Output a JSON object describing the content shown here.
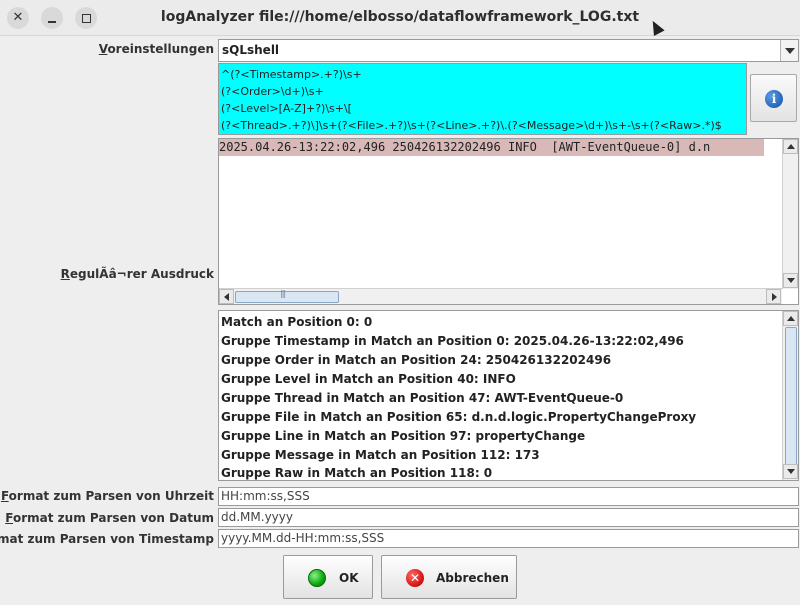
{
  "window": {
    "title": "logAnalyzer file:///home/elbosso/dataflowframework_LOG.txt",
    "close_glyph": "✕"
  },
  "presets": {
    "label_first": "V",
    "label_rest": "oreinstellungen",
    "selected": "sQLshell"
  },
  "regex": {
    "label_first": "R",
    "label_rest": "egulÃâ¬rer Ausdruck",
    "lines": [
      "^(?<Timestamp>.+?)\\s+",
      "(?<Order>\\d+)\\s+",
      "(?<Level>[A-Z]+?)\\s+\\[",
      "(?<Thread>.+?)\\]\\s+(?<File>.+?)\\s+(?<Line>.+?)\\.(?<Message>\\d+)\\s+-\\s+(?<Raw>.*)$"
    ],
    "info_glyph": "i"
  },
  "sample": {
    "line": "2025.04.26-13:22:02,496 250426132202496 INFO  [AWT-EventQueue-0] d.n"
  },
  "results": [
    "Match an Position 0: 0",
    "Gruppe Timestamp in Match an Position 0: 2025.04.26-13:22:02,496",
    "Gruppe Order in Match an Position 24: 250426132202496",
    "Gruppe Level in Match an Position 40: INFO",
    "Gruppe Thread in Match an Position 47: AWT-EventQueue-0",
    "Gruppe File in Match an Position 65: d.n.d.logic.PropertyChangeProxy",
    "Gruppe Line in Match an Position 97: propertyChange",
    "Gruppe Message in Match an Position 112: 173",
    "Gruppe Raw in Match an Position 118: 0"
  ],
  "formats": {
    "time": {
      "label_first": "F",
      "label_rest": "ormat zum Parsen von Uhrzeit",
      "value": "HH:mm:ss,SSS"
    },
    "date": {
      "label_first": "F",
      "label_rest": "ormat zum Parsen von Datum",
      "value": "dd.MM.yyyy"
    },
    "timestamp": {
      "label_first": "F",
      "label_rest": "ormat zum Parsen von Timestamp",
      "value": "yyyy.MM.dd-HH:mm:ss,SSS"
    }
  },
  "buttons": {
    "ok": "OK",
    "cancel": "Abbrechen",
    "cancel_glyph": "✕"
  }
}
